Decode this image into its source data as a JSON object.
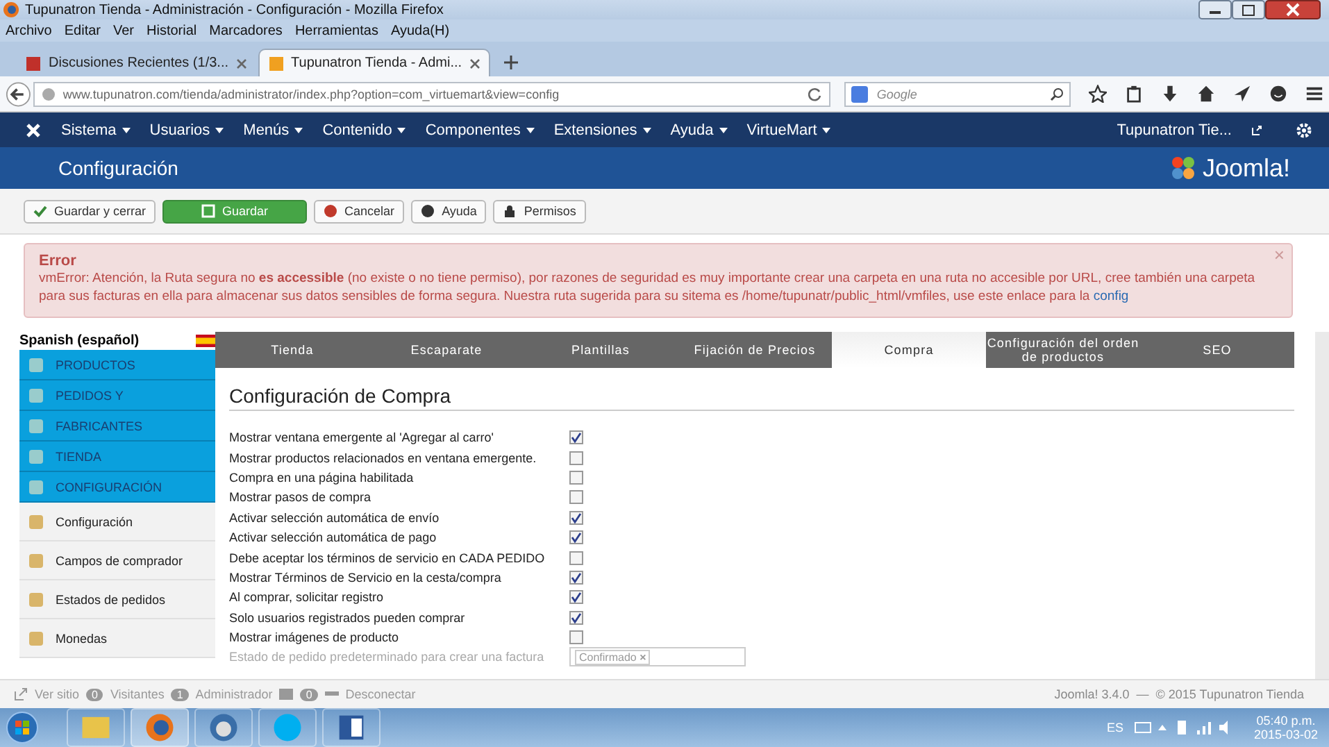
{
  "window": {
    "title": "Tupunatron Tienda - Administración - Configuración - Mozilla Firefox"
  },
  "menu": [
    "Archivo",
    "Editar",
    "Ver",
    "Historial",
    "Marcadores",
    "Herramientas",
    "Ayuda(H)"
  ],
  "browser_tabs": [
    {
      "label": "Discusiones Recientes (1/3...",
      "selected": false
    },
    {
      "label": "Tupunatron Tienda - Admi...",
      "selected": true
    }
  ],
  "address_bar": {
    "value": "www.tupunatron.com/tienda/administrator/index.php?option=com_virtuemart&view=config"
  },
  "search": {
    "placeholder": "Google"
  },
  "admin_nav": {
    "items": [
      "Sistema",
      "Usuarios",
      "Menús",
      "Contenido",
      "Componentes",
      "Extensiones",
      "Ayuda",
      "VirtueMart"
    ],
    "site_link": "Tupunatron Tie..."
  },
  "header": {
    "title": "Configuración",
    "logo": "Joomla!"
  },
  "toolbar": [
    {
      "label": "Guardar y cerrar",
      "kind": "check"
    },
    {
      "label": "Guardar",
      "kind": "save"
    },
    {
      "label": "Cancelar",
      "kind": "cancel"
    },
    {
      "label": "Ayuda",
      "kind": "help"
    },
    {
      "label": "Permisos",
      "kind": "lock"
    }
  ],
  "alert": {
    "title": "Error",
    "message": "vmError: Atención, la Ruta segura no **es accessible** (no existe o no tiene permiso), por razones de seguridad es muy importante crear una carpeta en una ruta no accesible por URL, cree también una carpeta para sus facturas en ella para almacenar sus datos sensibles de forma segura. Nuestra ruta sugerida para su sitema es /home/tupunatr/public_html/vmfiles, use este enlace para la",
    "link": "config",
    "close": "×"
  },
  "sidebar": {
    "language": "Spanish (español)",
    "items": [
      {
        "label": "PRODUCTOS",
        "kind": "category"
      },
      {
        "label": "PEDIDOS Y",
        "kind": "category"
      },
      {
        "label": "FABRICANTES",
        "kind": "category"
      },
      {
        "label": "TIENDA",
        "kind": "category"
      },
      {
        "label": "CONFIGURACIÓN",
        "kind": "category"
      },
      {
        "label": "Configuración",
        "kind": "item"
      },
      {
        "label": "Campos de comprador",
        "kind": "item"
      },
      {
        "label": "Estados de pedidos",
        "kind": "item"
      },
      {
        "label": "Monedas",
        "kind": "item"
      }
    ]
  },
  "tabs": [
    {
      "label": "Tienda",
      "selected": false
    },
    {
      "label": "Escaparate",
      "selected": false
    },
    {
      "label": "Plantillas",
      "selected": false
    },
    {
      "label": "Fijación de Precios",
      "selected": false
    },
    {
      "label": "Compra",
      "selected": true
    },
    {
      "label": "Configuración del orden de productos",
      "selected": false
    },
    {
      "label": "SEO",
      "selected": false
    }
  ],
  "panel": {
    "title": "Configuración de Compra",
    "options": [
      {
        "label": "Mostrar ventana emergente al 'Agregar al carro'",
        "checked": true
      },
      {
        "label": "Mostrar productos relacionados en ventana emergente.",
        "checked": false
      },
      {
        "label": "Compra en una página habilitada",
        "checked": false
      },
      {
        "label": "Mostrar pasos de compra",
        "checked": false
      },
      {
        "label": "Activar selección automática de envío",
        "checked": true
      },
      {
        "label": "Activar selección automática de pago",
        "checked": true
      },
      {
        "label": "Debe aceptar los términos de servicio en CADA PEDIDO",
        "checked": false
      },
      {
        "label": "Mostrar Términos de Servicio en la cesta/compra",
        "checked": true
      },
      {
        "label": "Al comprar, solicitar registro",
        "checked": true
      },
      {
        "label": "Solo usuarios registrados pueden comprar",
        "checked": true
      },
      {
        "label": "Mostrar imágenes de producto",
        "checked": false
      }
    ],
    "status_field": {
      "label": "Estado de pedido predeterminado para crear una factura",
      "tag": "Confirmado",
      "tag_remove": "×"
    }
  },
  "status_bar": {
    "view_site": "Ver sitio",
    "visitors_count": "0",
    "visitors": "Visitantes",
    "admins_count": "1",
    "admins": "Administrador",
    "messages_count": "0",
    "logout": "Desconectar",
    "footer": "Joomla! 3.4.0  —  © 2015 Tupunatron Tienda"
  },
  "taskbar": {
    "language": "ES",
    "time": "05:40 p.m.",
    "date": "2015-03-02"
  }
}
